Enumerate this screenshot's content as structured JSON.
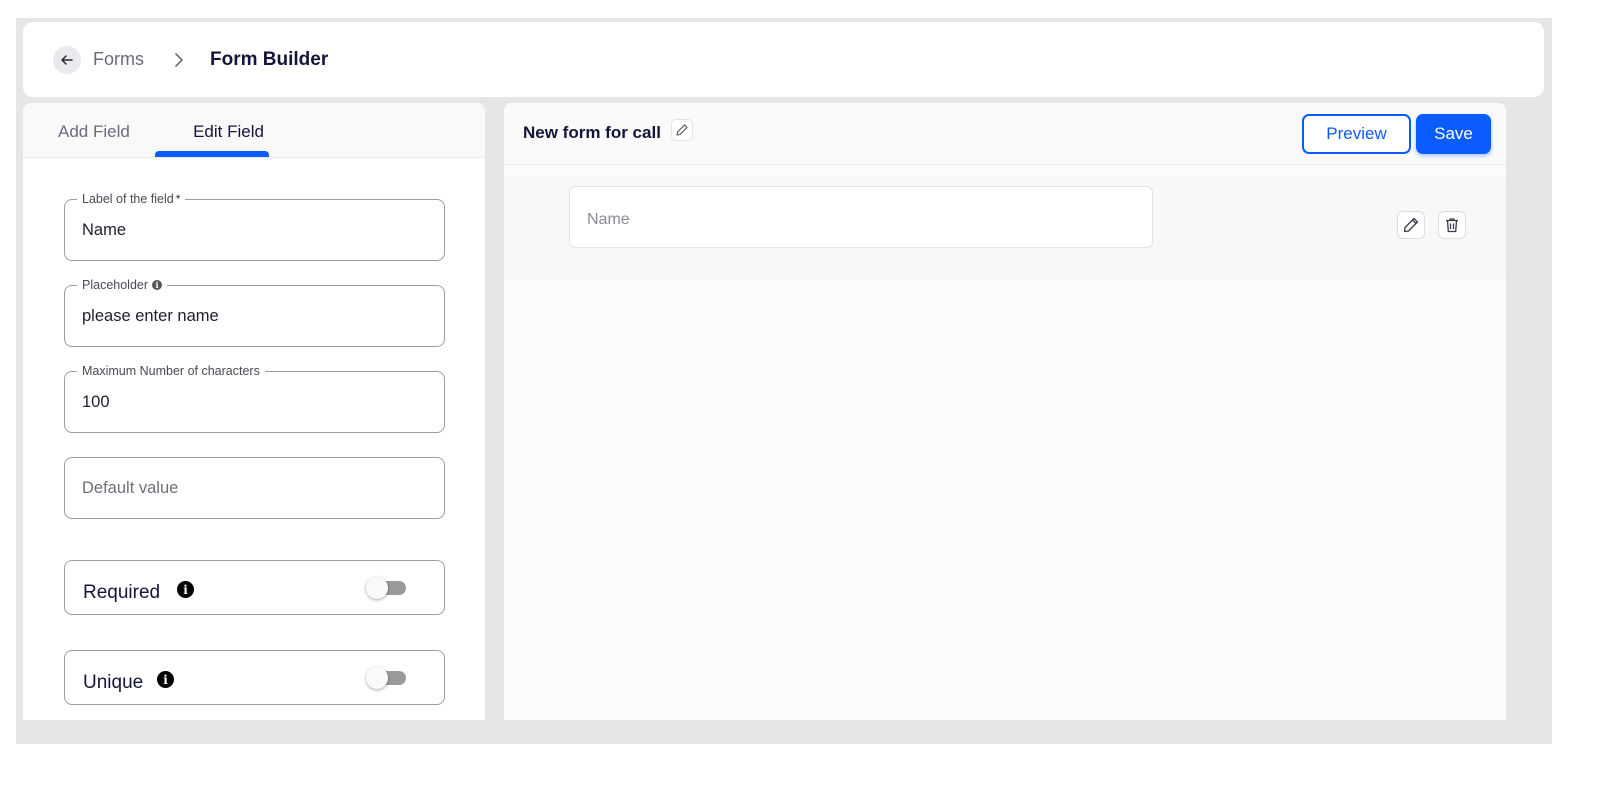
{
  "breadcrumb": {
    "back_icon": "arrow-left-icon",
    "parent_label": "Forms",
    "separator_icon": "chevron-right-icon",
    "current_label": "Form Builder"
  },
  "left_panel": {
    "tabs": [
      {
        "label": "Add Field",
        "active": false
      },
      {
        "label": "Edit Field",
        "active": true
      }
    ],
    "fields": {
      "label": {
        "legend": "Label of the field",
        "required_mark": "*",
        "value": "Name"
      },
      "placeholder": {
        "legend": "Placeholder",
        "info_icon": "info-icon",
        "value": "please enter name"
      },
      "max_chars": {
        "legend": "Maximum Number of characters",
        "value": "100"
      },
      "default_value": {
        "placeholder": "Default value"
      }
    },
    "toggles": [
      {
        "label": "Required",
        "on": false
      },
      {
        "label": "Unique",
        "on": false
      }
    ]
  },
  "right_panel": {
    "form_title": "New form for call",
    "title_edit_icon": "pencil-icon",
    "preview_label": "Preview",
    "save_label": "Save",
    "preview_field_placeholder": "Name",
    "row_actions": [
      "pencil-icon",
      "trash-icon"
    ]
  },
  "colors": {
    "accent": "#0a5cff",
    "toggle_off": "#9a9a9a"
  }
}
